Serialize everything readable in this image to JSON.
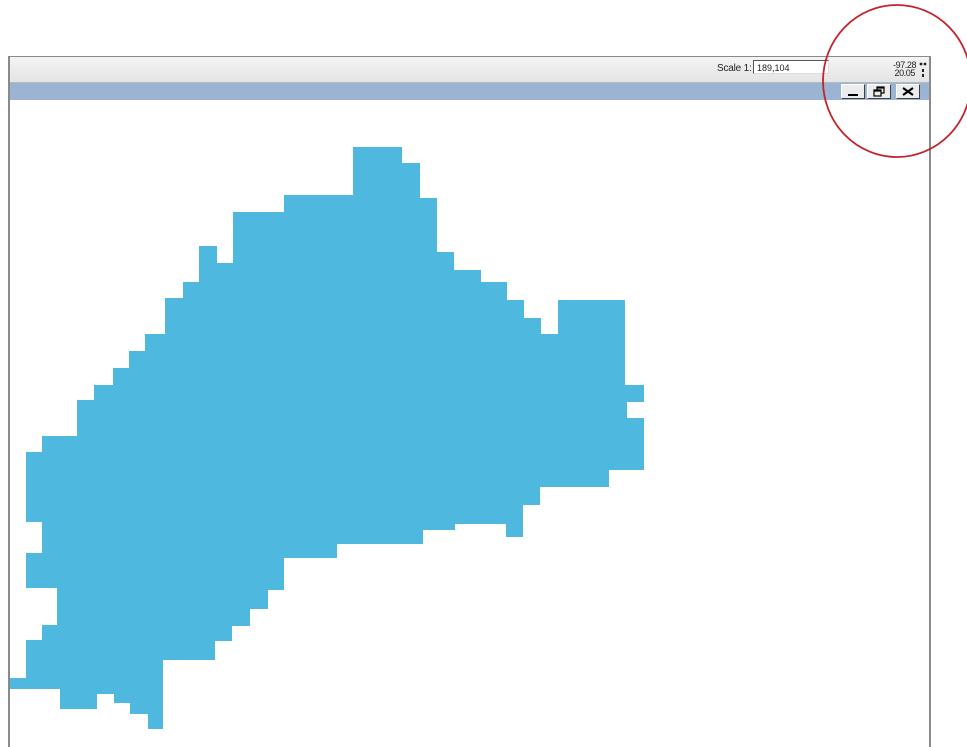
{
  "status_bar": {
    "scale_label": "Scale 1:",
    "scale_value": "189,104",
    "coord_line_1": "-97.28",
    "coord_line_2": "20.05"
  },
  "title_bar": {
    "minimize_icon": "minimize-icon",
    "restore_icon": "restore-icon",
    "close_icon": "close-icon"
  },
  "map": {
    "region_fill_color": "#4fb8df",
    "background_color": "#ffffff"
  },
  "annotation": {
    "ring_color": "#c4232b"
  }
}
